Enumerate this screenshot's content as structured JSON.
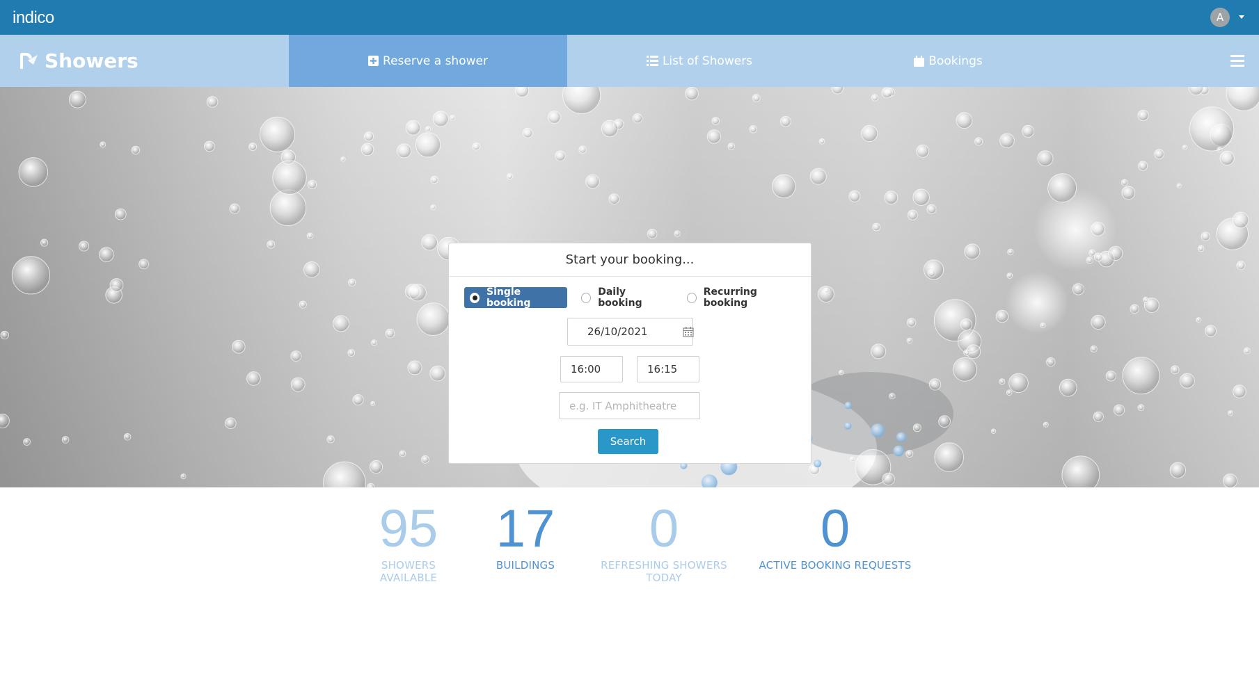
{
  "topbar": {
    "logo_text": "indico",
    "user_initial": "A",
    "color": "#1f7bb0"
  },
  "navbar": {
    "brand": "Showers",
    "items": [
      {
        "label": "Reserve a shower",
        "icon": "plus-square-icon",
        "active": true
      },
      {
        "label": "List of Showers",
        "icon": "list-icon",
        "active": false
      },
      {
        "label": "Bookings",
        "icon": "calendar-icon",
        "active": false
      }
    ]
  },
  "booking": {
    "title": "Start your booking...",
    "types": [
      {
        "label": "Single booking",
        "selected": true
      },
      {
        "label": "Daily booking",
        "selected": false
      },
      {
        "label": "Recurring booking",
        "selected": false
      }
    ],
    "date": "26/10/2021",
    "start_time": "16:00",
    "end_time": "16:15",
    "location_placeholder": "e.g. IT Amphitheatre",
    "search_label": "Search"
  },
  "stats": [
    {
      "value": "95",
      "label": "SHOWERS AVAILABLE"
    },
    {
      "value": "17",
      "label": "BUILDINGS"
    },
    {
      "value": "0",
      "label": "REFRESHING SHOWERS TODAY"
    },
    {
      "value": "0",
      "label": "ACTIVE BOOKING REQUESTS"
    }
  ],
  "colors": {
    "accent": "#2997c8",
    "nav_bg": "#b0d0ec",
    "nav_active": "#71a8dd",
    "stat_light": "#a9cceb",
    "stat_dark": "#4f92d1"
  }
}
